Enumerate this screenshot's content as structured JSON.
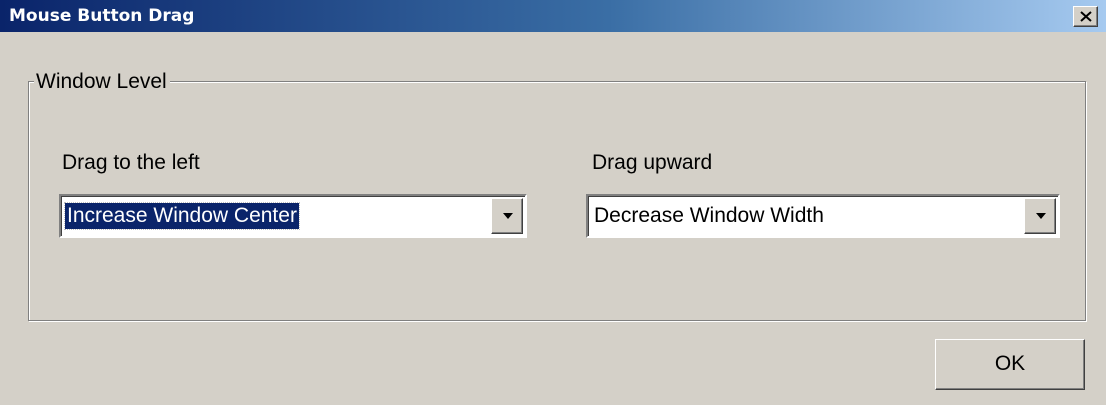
{
  "window": {
    "title": "Mouse Button Drag",
    "close_icon": "close-icon"
  },
  "group": {
    "legend": "Window Level"
  },
  "left_drag": {
    "label": "Drag to the left",
    "selected": "Increase Window Center",
    "dropdown_icon": "chevron-down-icon"
  },
  "up_drag": {
    "label": "Drag upward",
    "selected": "Decrease Window Width",
    "dropdown_icon": "chevron-down-icon"
  },
  "buttons": {
    "ok": "OK"
  },
  "colors": {
    "titlebar_start": "#0a246a",
    "titlebar_end": "#a6caf0",
    "dialog_bg": "#d4d0c8",
    "selection_bg": "#0a246a"
  }
}
